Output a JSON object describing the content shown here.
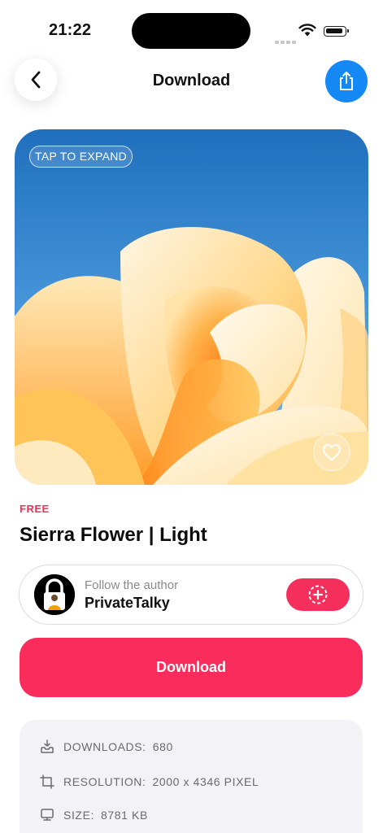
{
  "status_bar": {
    "time": "21:22"
  },
  "nav": {
    "title": "Download"
  },
  "wallpaper": {
    "tap_label": "TAP TO EXPAND",
    "colors": {
      "sky_top": "#1f6fbd",
      "sky_bottom": "#5aa7e4",
      "petal_light": "#fff4dc",
      "petal_mid": "#ffd27a",
      "petal_deep": "#ff9a2a"
    }
  },
  "item": {
    "price": "FREE",
    "title": "Sierra Flower | Light"
  },
  "author": {
    "follow_label": "Follow the author",
    "name": "PrivateTalky"
  },
  "download": {
    "label": "Download"
  },
  "stats": {
    "downloads_label": "DOWNLOADS:",
    "downloads_value": "680",
    "resolution_label": "RESOLUTION:",
    "resolution_value": "2000 x 4346 PIXEL",
    "size_label": "SIZE:",
    "size_value": "8781 KB"
  },
  "colors": {
    "accent": "#f92c5b",
    "share": "#1489f5"
  }
}
